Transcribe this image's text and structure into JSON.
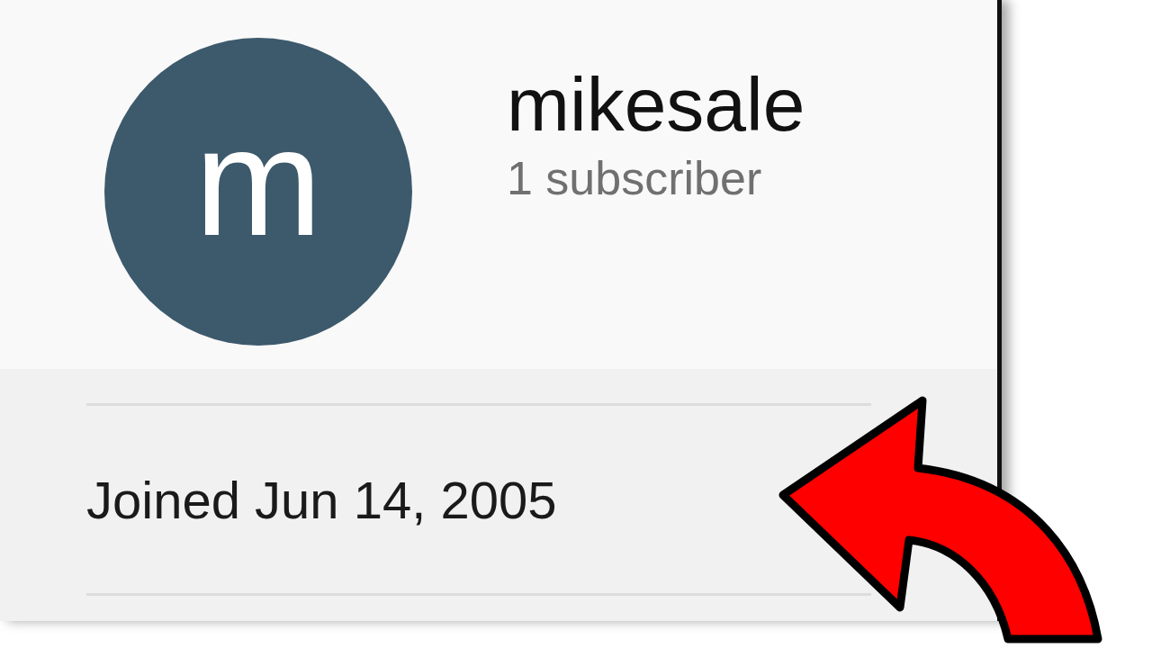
{
  "channel": {
    "avatar_letter": "m",
    "name": "mikesale",
    "subscribers": "1 subscriber"
  },
  "details": [
    {
      "text": "Joined Jun 14, 2005"
    }
  ]
}
